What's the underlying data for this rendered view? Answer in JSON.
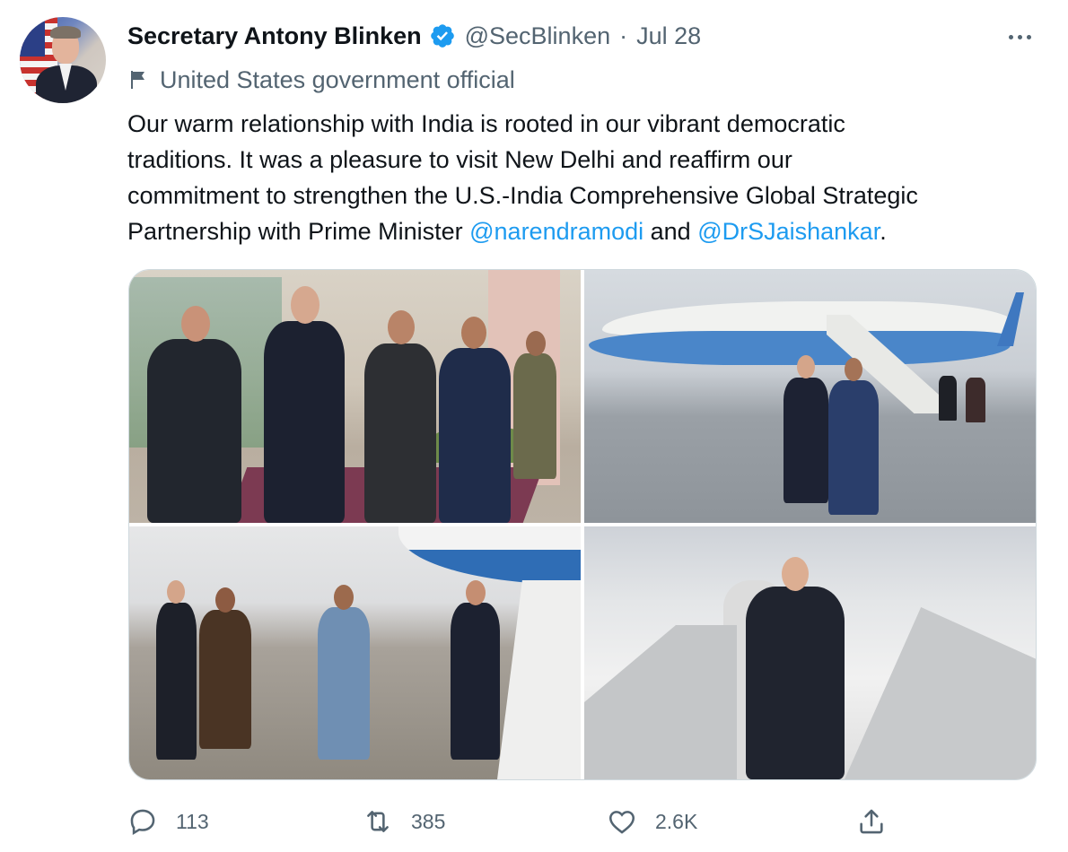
{
  "tweet": {
    "author_name": "Secretary Antony Blinken",
    "handle": "@SecBlinken",
    "separator": "·",
    "date": "Jul 28",
    "account_label": "United States government official",
    "text_lines": [
      "Our warm relationship with India is rooted in our vibrant democratic",
      "traditions. It was a pleasure to visit New Delhi and reaffirm our",
      "commitment to strengthen the U.S.-India Comprehensive Global Strategic"
    ],
    "text_last_prefix": "Partnership with Prime Minister ",
    "mention_1": "@narendramodi",
    "text_last_middle": " and ",
    "mention_2": "@DrSJaishankar",
    "text_last_suffix": ".",
    "icons": {
      "verified": "verified-badge-icon",
      "more": "more-options-icon",
      "label": "flag-icon",
      "reply": "reply-icon",
      "retweet": "retweet-icon",
      "like": "like-icon",
      "share": "share-icon"
    },
    "colors": {
      "accent": "#1d9bf0",
      "secondary_text": "#536471",
      "primary_text": "#0f1419"
    }
  },
  "engagement": {
    "replies": "113",
    "retweets": "385",
    "likes": "2.6K"
  }
}
